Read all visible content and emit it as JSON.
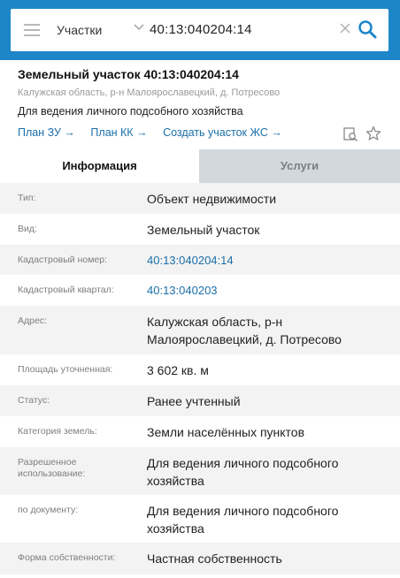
{
  "search": {
    "type_label": "Участки",
    "query": "40:13:040204:14"
  },
  "card": {
    "title": "Земельный участок 40:13:040204:14",
    "address_short": "Калужская область, р-н Малоярославецкий, д. Потресово",
    "purpose": "Для ведения личного подсобного хозяйства",
    "links": [
      "План ЗУ →",
      "План КК →",
      "Создать участок ЖС →"
    ]
  },
  "tabs": [
    "Информация",
    "Услуги"
  ],
  "rows": [
    {
      "label": "Тип:",
      "value": "Объект недвижимости"
    },
    {
      "label": "Вид:",
      "value": "Земельный участок"
    },
    {
      "label": "Кадастровый номер:",
      "value": "40:13:040204:14"
    },
    {
      "label": "Кадастровый квартал:",
      "value": "40:13:040203"
    },
    {
      "label": "Адрес:",
      "value": "Калужская область, р-н Малоярославецкий, д. Потресово"
    },
    {
      "label": "Площадь уточненная:",
      "value": "3 602 кв. м"
    },
    {
      "label": "Статус:",
      "value": "Ранее учтенный"
    },
    {
      "label": "Категория земель:",
      "value": "Земли населённых пунктов"
    },
    {
      "label": "Разрешенное использование:",
      "value": "Для ведения личного подсобного хозяйства"
    },
    {
      "label": "по документу:",
      "value": "Для ведения личного подсобного хозяйства"
    },
    {
      "label": "Форма собственности:",
      "value": "Частная собственность"
    }
  ],
  "colors": {
    "header_bg": "#1d86c9",
    "link": "#1b6fa8",
    "search_icon": "#1d86c9"
  }
}
